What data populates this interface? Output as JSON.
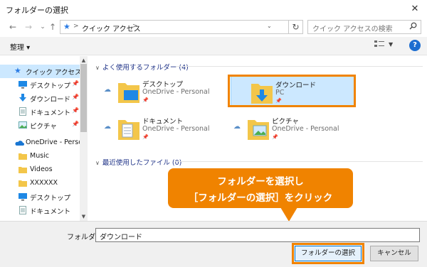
{
  "window": {
    "title": "フォルダーの選択",
    "close_glyph": "✕"
  },
  "nav": {
    "back": "←",
    "forward": "→",
    "dropdown": "⌄",
    "up": "↑"
  },
  "address": {
    "location": "クイック アクセス",
    "sep": ">"
  },
  "search": {
    "placeholder": "クイック アクセスの検索"
  },
  "toolbar": {
    "organize_label": "整理 ▾",
    "help": "?"
  },
  "sidebar": {
    "items": [
      {
        "label": "クイック アクセス",
        "icon": "star-icon",
        "pinned": false,
        "selected": true
      },
      {
        "label": "デスクトップ",
        "icon": "desktop-icon",
        "pinned": true
      },
      {
        "label": "ダウンロード",
        "icon": "download-icon",
        "pinned": true
      },
      {
        "label": "ドキュメント",
        "icon": "document-icon",
        "pinned": true
      },
      {
        "label": "ピクチャ",
        "icon": "picture-icon",
        "pinned": true
      },
      {
        "label": "OneDrive - Person",
        "icon": "onedrive-icon",
        "pinned": false
      },
      {
        "label": "Music",
        "icon": "folder-icon",
        "pinned": false
      },
      {
        "label": "Videos",
        "icon": "folder-icon",
        "pinned": false
      },
      {
        "label": "XXXXXX",
        "icon": "folder-icon",
        "pinned": false
      },
      {
        "label": "デスクトップ",
        "icon": "desktop-icon",
        "pinned": false
      },
      {
        "label": "ドキュメント",
        "icon": "document-icon",
        "pinned": false
      }
    ]
  },
  "main": {
    "group1": {
      "label": "よく使用するフォルダー (4)"
    },
    "group2": {
      "label": "最近使用したファイル (0)"
    },
    "folders": [
      {
        "name": "デスクトップ",
        "location": "OneDrive - Personal",
        "icon": "desktop-folder-icon"
      },
      {
        "name": "ダウンロード",
        "location": "PC",
        "icon": "download-folder-icon",
        "selected": true
      },
      {
        "name": "ドキュメント",
        "location": "OneDrive - Personal",
        "icon": "document-folder-icon"
      },
      {
        "name": "ピクチャ",
        "location": "OneDrive - Personal",
        "icon": "picture-folder-icon"
      }
    ]
  },
  "callout": {
    "line1": "フォルダーを選択し",
    "line2": "［フォルダーの選択］をクリック"
  },
  "bottom": {
    "folder_label": "フォルダー:",
    "folder_value": "ダウンロード",
    "select_label": "フォルダーの選択",
    "cancel_label": "キャンセル"
  },
  "colors": {
    "accent": "#f08300",
    "selection": "#cce8ff",
    "link": "#1e3287"
  }
}
